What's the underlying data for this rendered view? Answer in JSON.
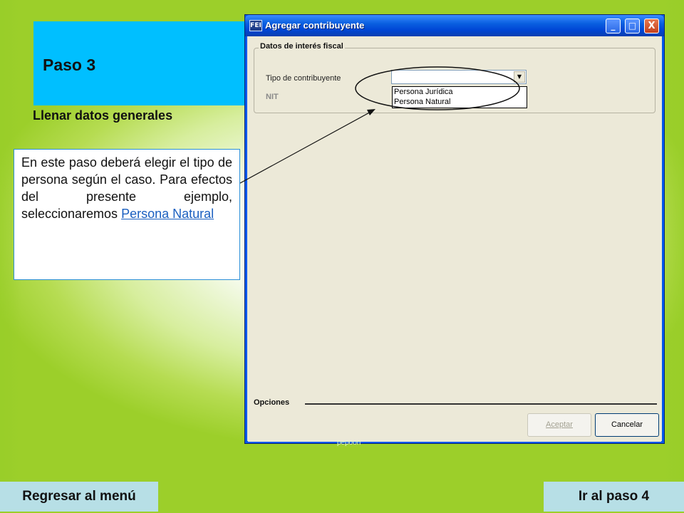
{
  "step": {
    "title": "Paso 3",
    "subtitle": "Llenar datos generales"
  },
  "instructions": {
    "text": "En este paso deberá elegir el tipo de persona según el caso. Para efectos del presente ejemplo, seleccionaremos ",
    "link_text": "Persona Natural"
  },
  "dialog": {
    "title": "Agregar contribuyente",
    "app_icon": "app-icon",
    "controls": {
      "minimize": "_",
      "maximize": "□",
      "close": "X"
    },
    "groupbox_title": "Datos de interés fiscal",
    "tipo_label": "Tipo de contribuyente",
    "tipo_value": "",
    "nit_label": "NIT",
    "options": [
      "Persona Jurídica",
      "Persona Natural"
    ],
    "options_section": "Opciones",
    "accept_label": "Aceptar",
    "cancel_label": "Cancelar",
    "below_text": "pepoon"
  },
  "nav": {
    "prev_label": "Regresar al menú",
    "next_label": "Ir al paso 4"
  },
  "colors": {
    "step_box": "#00bfff",
    "titlebar": "#0046d5",
    "nav_button": "#b7dfe6",
    "link": "#1a5fc0"
  }
}
